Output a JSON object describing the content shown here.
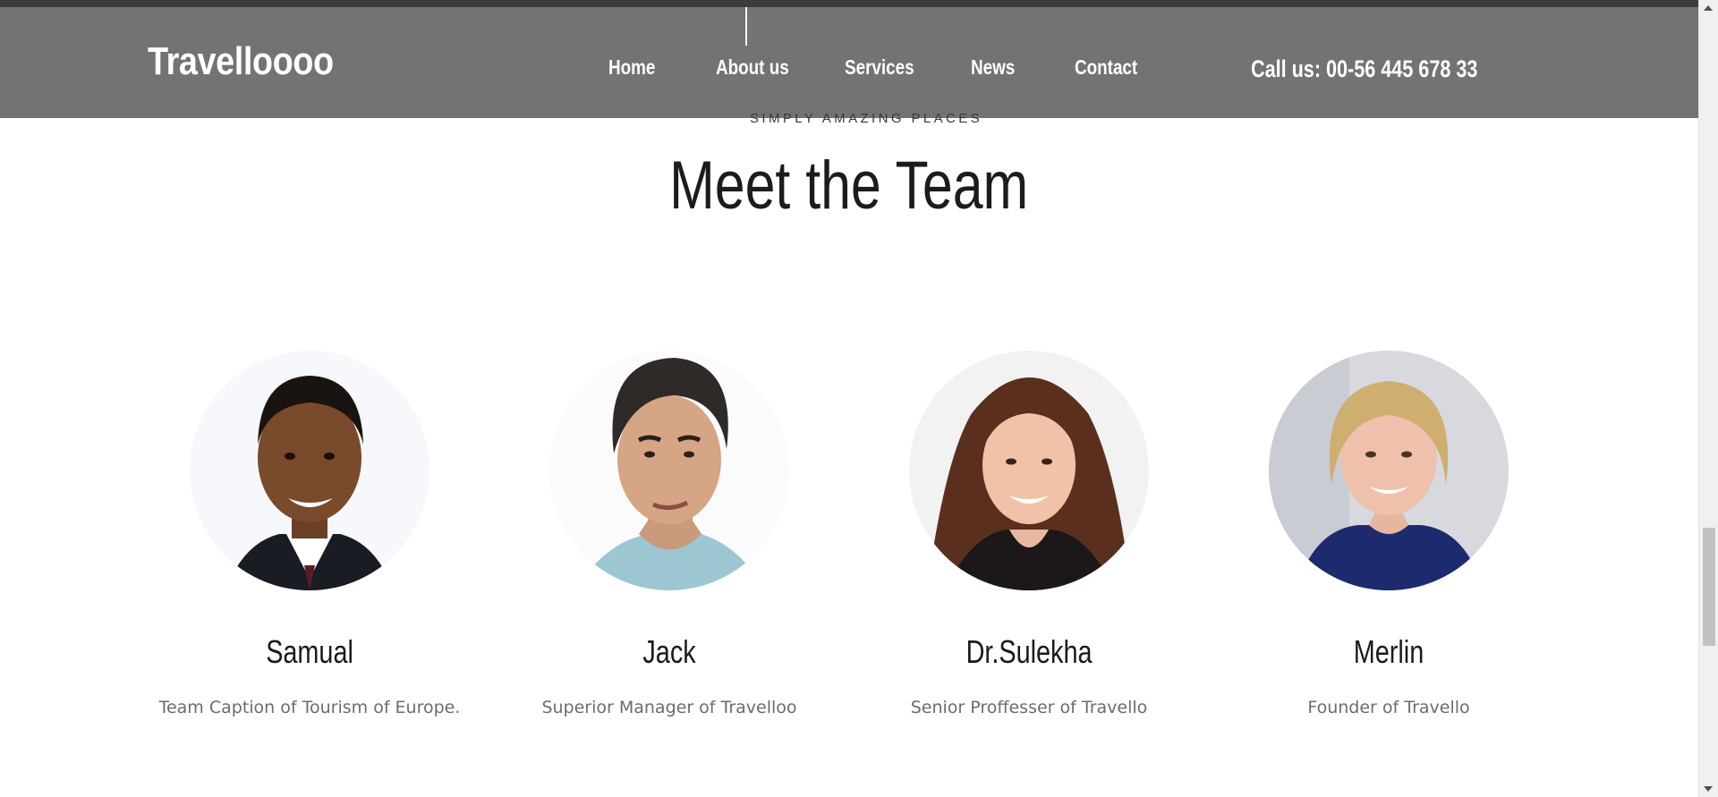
{
  "header": {
    "logo": "Travelloooo",
    "nav": [
      {
        "label": "Home"
      },
      {
        "label": "About us"
      },
      {
        "label": "Services"
      },
      {
        "label": "News"
      },
      {
        "label": "Contact"
      }
    ],
    "call": "Call us: 00-56 445 678 33",
    "tagline": "SIMPLY AMAZING PLACES"
  },
  "main": {
    "title": "Meet the Team",
    "team": [
      {
        "name": "Samual",
        "role": "Team Caption of Tourism of Europe."
      },
      {
        "name": "Jack",
        "role": "Superior Manager of Travelloo"
      },
      {
        "name": "Dr.Sulekha",
        "role": "Senior Proffesser of Travello"
      },
      {
        "name": "Merlin",
        "role": "Founder of Travello"
      }
    ]
  },
  "colors": {
    "header_bg": "#737373",
    "top_strip": "#3a3a3f",
    "title_text": "#1c1c1c",
    "role_text": "#6b6b74"
  }
}
